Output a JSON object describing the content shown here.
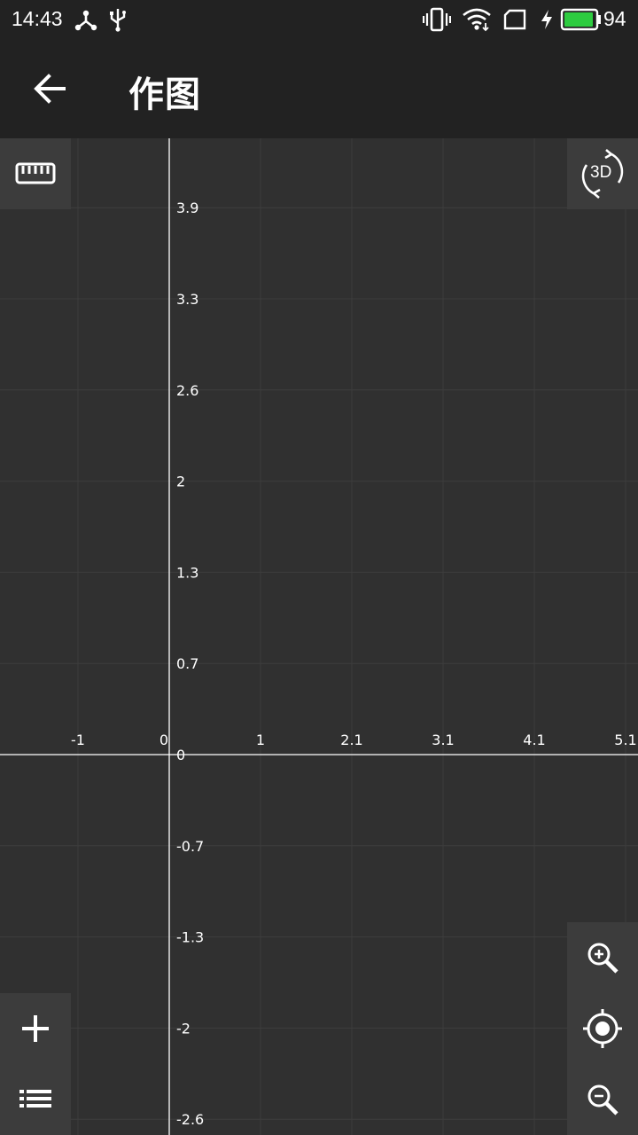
{
  "status_bar": {
    "time": "14:43",
    "battery_percent": "94",
    "battery_color": "#2ecc40",
    "icons": [
      "nodes-icon",
      "usb-icon",
      "vibrate-icon",
      "wifi-icon",
      "sim-icon",
      "charging-icon",
      "battery-icon"
    ]
  },
  "app_bar": {
    "title": "作图",
    "back_icon": "arrow-left-icon"
  },
  "toolbar": {
    "ruler_icon": "ruler-icon",
    "rotate_3d_label": "3D",
    "add_icon": "plus-icon",
    "list_icon": "list-icon",
    "zoom_in_icon": "zoom-in-icon",
    "locate_icon": "crosshair-icon",
    "zoom_out_icon": "zoom-out-icon"
  },
  "chart_data": {
    "type": "line",
    "grid": true,
    "x_ticks": [
      {
        "value": -1,
        "label": "-1"
      },
      {
        "value": 0,
        "label": "0"
      },
      {
        "value": 1,
        "label": "1"
      },
      {
        "value": 2,
        "label": "2.1"
      },
      {
        "value": 3,
        "label": "3.1"
      },
      {
        "value": 4,
        "label": "4.1"
      },
      {
        "value": 5,
        "label": "5.1"
      }
    ],
    "y_ticks": [
      {
        "value": 6,
        "label": "3.9"
      },
      {
        "value": 5,
        "label": "3.3"
      },
      {
        "value": 4,
        "label": "2.6"
      },
      {
        "value": 3,
        "label": "2"
      },
      {
        "value": 2,
        "label": "1.3"
      },
      {
        "value": 1,
        "label": "0.7"
      },
      {
        "value": 0,
        "label": "0"
      },
      {
        "value": -1,
        "label": "-0.7"
      },
      {
        "value": -2,
        "label": "-1.3"
      },
      {
        "value": -3,
        "label": "-2"
      },
      {
        "value": -4,
        "label": "-2.6"
      }
    ],
    "colors": {
      "background": "#303030",
      "grid": "#3d3d3d",
      "axis": "#ffffff"
    }
  }
}
